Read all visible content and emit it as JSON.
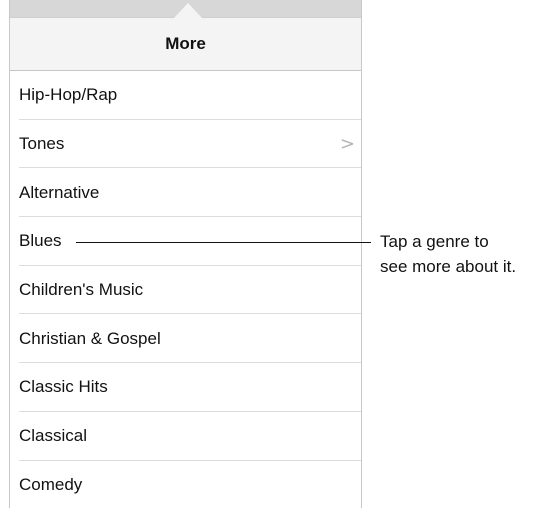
{
  "nav": {
    "title": "More"
  },
  "genres": [
    {
      "label": "Hip-Hop/Rap",
      "has_chevron": false
    },
    {
      "label": "Tones",
      "has_chevron": true
    },
    {
      "label": "Alternative",
      "has_chevron": false
    },
    {
      "label": "Blues",
      "has_chevron": false
    },
    {
      "label": "Children's Music",
      "has_chevron": false
    },
    {
      "label": "Christian & Gospel",
      "has_chevron": false
    },
    {
      "label": "Classic Hits",
      "has_chevron": false
    },
    {
      "label": "Classical",
      "has_chevron": false
    },
    {
      "label": "Comedy",
      "has_chevron": false
    }
  ],
  "chevron_glyph": ">",
  "callout": {
    "line1": "Tap a genre to",
    "line2": "see more about it."
  }
}
